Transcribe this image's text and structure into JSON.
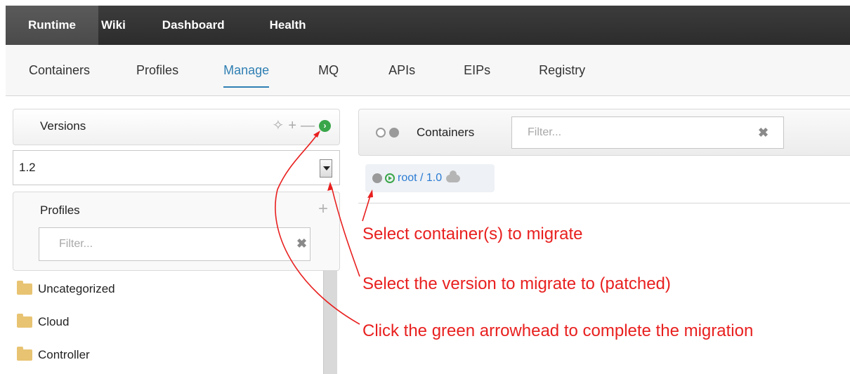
{
  "topnav": {
    "tabs": [
      {
        "label": "Runtime",
        "active": true
      },
      {
        "label": "Wiki"
      },
      {
        "label": "Dashboard"
      },
      {
        "label": "Health"
      }
    ]
  },
  "subnav": {
    "tabs": [
      {
        "label": "Containers"
      },
      {
        "label": "Profiles"
      },
      {
        "label": "Manage",
        "active": true
      },
      {
        "label": "MQ"
      },
      {
        "label": "APIs"
      },
      {
        "label": "EIPs"
      },
      {
        "label": "Registry"
      }
    ]
  },
  "versions": {
    "title": "Versions",
    "selected": "1.2",
    "icons": [
      "move-icon",
      "plus-icon",
      "minus-icon",
      "go-arrow-icon"
    ]
  },
  "profiles": {
    "title": "Profiles",
    "filter_placeholder": "Filter...",
    "items": [
      {
        "label": "Uncategorized"
      },
      {
        "label": "Cloud"
      },
      {
        "label": "Controller"
      }
    ]
  },
  "containers": {
    "title": "Containers",
    "filter_placeholder": "Filter...",
    "row": {
      "link": "root / 1.0"
    }
  },
  "annotations": {
    "line1": "Select container(s) to migrate",
    "line2": "Select the version to migrate to (patched)",
    "line3": "Click the green arrowhead to complete the migration",
    "color": "#e8201f"
  },
  "colors": {
    "accent": "#2f7fb3",
    "link": "#2a7bd4",
    "go_green": "#3aa64a",
    "folder": "#e8c372"
  }
}
